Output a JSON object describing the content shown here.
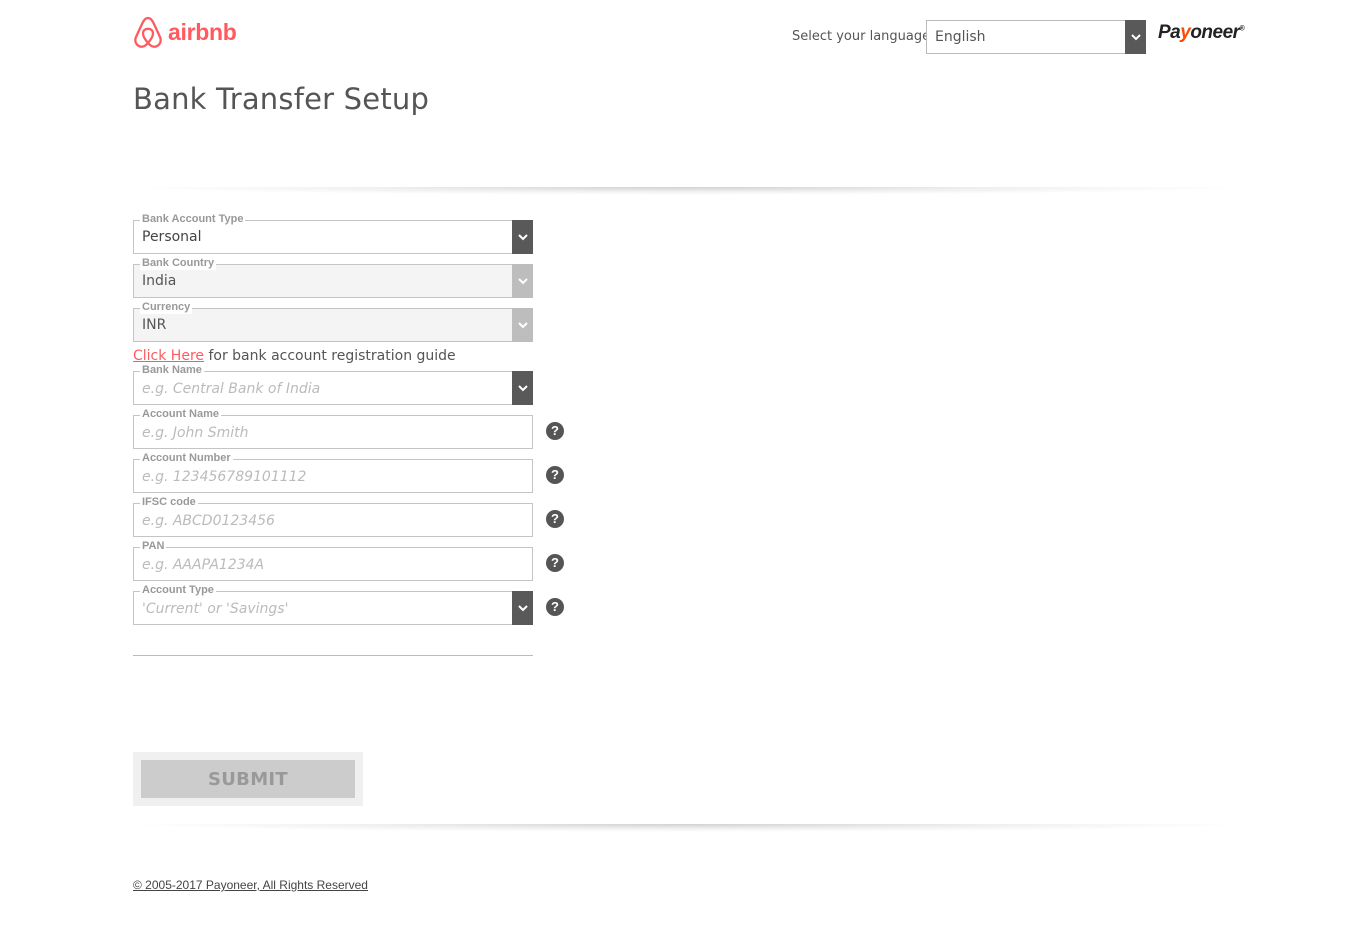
{
  "header": {
    "logo_text": "airbnb",
    "language_label": "Select your language:",
    "language_value": "English",
    "partner_logo_prefix": "Pa",
    "partner_logo_y": "y",
    "partner_logo_suffix": "oneer",
    "partner_logo_mark": "®"
  },
  "page_title": "Bank Transfer Setup",
  "form": {
    "bank_account_type": {
      "label": "Bank Account Type",
      "value": "Personal"
    },
    "bank_country": {
      "label": "Bank Country",
      "value": "India"
    },
    "currency": {
      "label": "Currency",
      "value": "INR"
    },
    "guide_link": "Click Here",
    "guide_text": " for bank account registration guide",
    "bank_name": {
      "label": "Bank Name",
      "placeholder": "e.g. Central Bank of India"
    },
    "account_name": {
      "label": "Account Name",
      "placeholder": "e.g. John Smith"
    },
    "account_number": {
      "label": "Account Number",
      "placeholder": "e.g. 123456789101112"
    },
    "ifsc_code": {
      "label": "IFSC code",
      "placeholder": "e.g. ABCD0123456"
    },
    "pan": {
      "label": "PAN",
      "placeholder": "e.g. AAAPA1234A"
    },
    "account_type": {
      "label": "Account Type",
      "placeholder": "'Current' or 'Savings'"
    },
    "help_glyph": "?"
  },
  "submit_label": "SUBMIT",
  "footer_text": "© 2005-2017 Payoneer, All Rights Reserved",
  "colors": {
    "brand": "#ff5a5f",
    "payoneer_accent": "#ff4800",
    "dropdown_button": "#595959",
    "dropdown_disabled": "#bdbdbd"
  },
  "icons": {
    "logo": "airbnb-belo-icon",
    "dropdown": "chevron-down-icon",
    "help": "question-circle-icon"
  }
}
